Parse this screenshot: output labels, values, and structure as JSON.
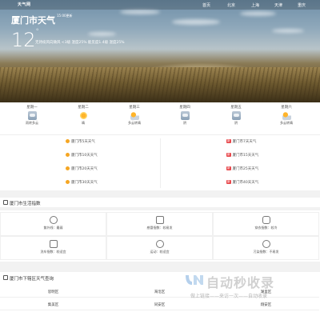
{
  "header": {
    "logo": "天气网",
    "nav": [
      "首页",
      "北京",
      "上海",
      "天津",
      "重庆"
    ],
    "city_title": "厦门市天气",
    "updated": "15:00更新",
    "temperature": "12",
    "temp_unit": "°",
    "conditions": "无持续风向微风 <3级 湿度25% 能见度1.4级 湿度25%"
  },
  "week": [
    {
      "day": "星期一",
      "label": "雨转多云",
      "icon": "cloud-rain-icon"
    },
    {
      "day": "星期二",
      "label": "晴",
      "icon": "sun-icon"
    },
    {
      "day": "星期三",
      "label": "多云转晴",
      "icon": "partly-cloudy-icon"
    },
    {
      "day": "星期四",
      "label": "阴",
      "icon": "cloud-icon"
    },
    {
      "day": "星期五",
      "label": "阴",
      "icon": "cloud-icon"
    },
    {
      "day": "星期六",
      "label": "多云转晴",
      "icon": "partly-cloudy-icon"
    }
  ],
  "forecast_links": {
    "left": [
      "厦门市5天天气",
      "厦门市10天天气",
      "厦门市20天天气",
      "厦门市30天天气"
    ],
    "right": [
      "厦门市7天天气",
      "厦门市15天天气",
      "厦门市25天天气",
      "厦门市40天天气"
    ],
    "tag": "新"
  },
  "life_index": {
    "title": "厦门市生活指数",
    "items": [
      {
        "text": "紫外线：最弱",
        "icon": "sun-outline-icon"
      },
      {
        "text": "感冒指数：较易发",
        "icon": "medicine-kit-icon"
      },
      {
        "text": "穿衣指数：较冷",
        "icon": "clothes-icon"
      },
      {
        "text": "洗车指数：较适宜",
        "icon": "car-icon"
      },
      {
        "text": "运动：较适宜",
        "icon": "running-icon"
      },
      {
        "text": "污染指数：不易发",
        "icon": "pollution-icon"
      }
    ]
  },
  "districts": {
    "title": "厦门市下辖区天气查询",
    "items": [
      "思明区",
      "海沧区",
      "湖里区",
      "集美区",
      "同安区",
      "翔安区"
    ]
  },
  "watermark": {
    "title": "自动秒收录",
    "subtitle": "做上链接——来访一次——自动收录"
  },
  "colors": {
    "accent": "#2f6fd1",
    "tag_red": "#e8474b",
    "sun_orange": "#f5a623"
  }
}
